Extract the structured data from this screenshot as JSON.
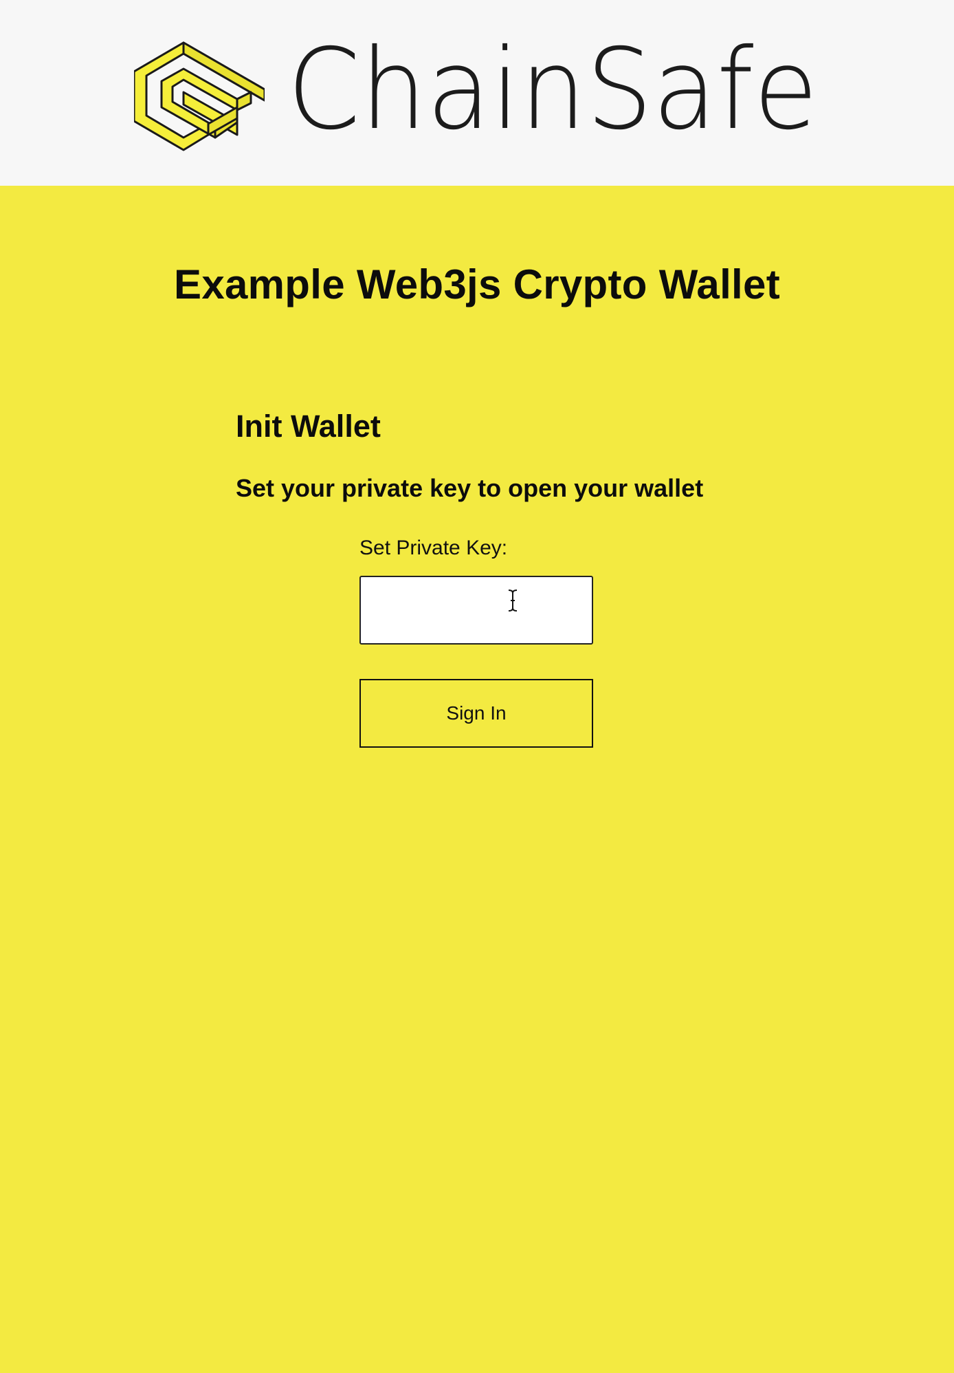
{
  "brand": {
    "name": "ChainSafe",
    "logo_icon": "chainsafe-logo-icon",
    "logo_color": "#f5ee3a",
    "logo_outline": "#1a1a1a"
  },
  "page": {
    "title": "Example Web3js Crypto Wallet"
  },
  "wallet_init": {
    "heading": "Init Wallet",
    "subheading": "Set your private key to open your wallet",
    "private_key_label": "Set Private Key:",
    "private_key_value": "",
    "sign_in_label": "Sign In"
  },
  "colors": {
    "header_background": "#f7f7f7",
    "page_background": "#f3ea41",
    "text": "#0c0c0c"
  },
  "cursor": {
    "icon": "text-cursor-icon"
  }
}
